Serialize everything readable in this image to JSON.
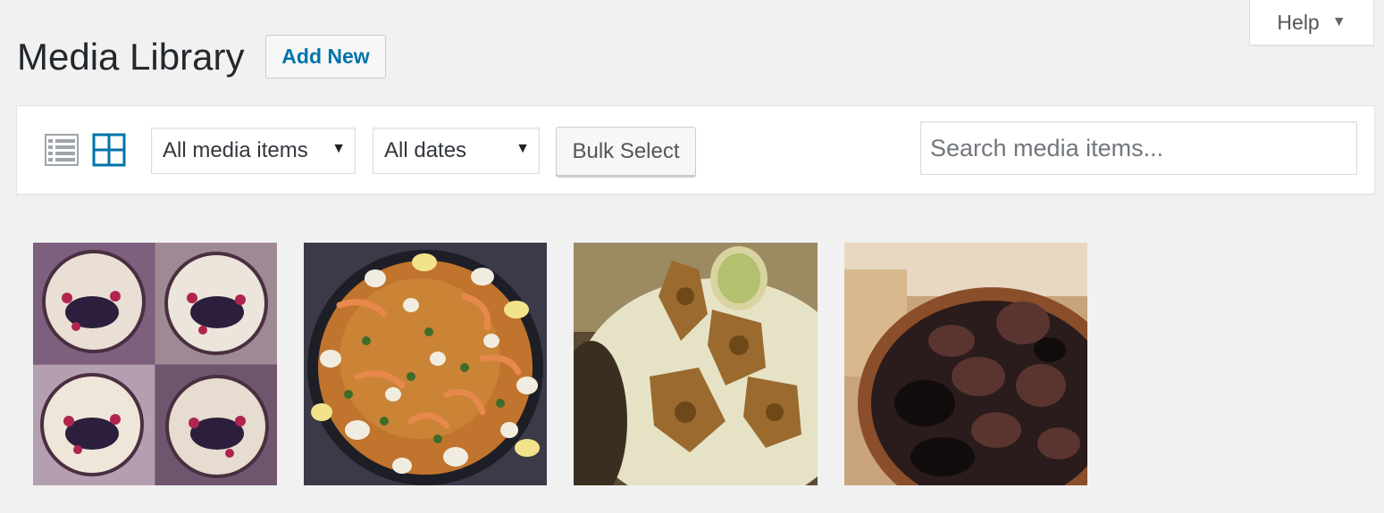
{
  "header": {
    "title": "Media Library",
    "add_new_label": "Add New",
    "help_label": "Help"
  },
  "toolbar": {
    "view_modes": [
      "list-view-icon",
      "grid-view-icon"
    ],
    "active_view": "grid",
    "media_filter": {
      "selected": "All media items"
    },
    "date_filter": {
      "selected": "All dates"
    },
    "bulk_select_label": "Bulk Select",
    "search": {
      "placeholder": "Search media items...",
      "value": ""
    }
  },
  "media_items": [
    {
      "subject": "four-berry-tarts"
    },
    {
      "subject": "seafood-paella"
    },
    {
      "subject": "fried-artichokes"
    },
    {
      "subject": "pot-of-mussels"
    }
  ],
  "colors": {
    "accent": "#0073aa",
    "background": "#f1f1f1",
    "inactive_icon": "#a0a5aa"
  }
}
